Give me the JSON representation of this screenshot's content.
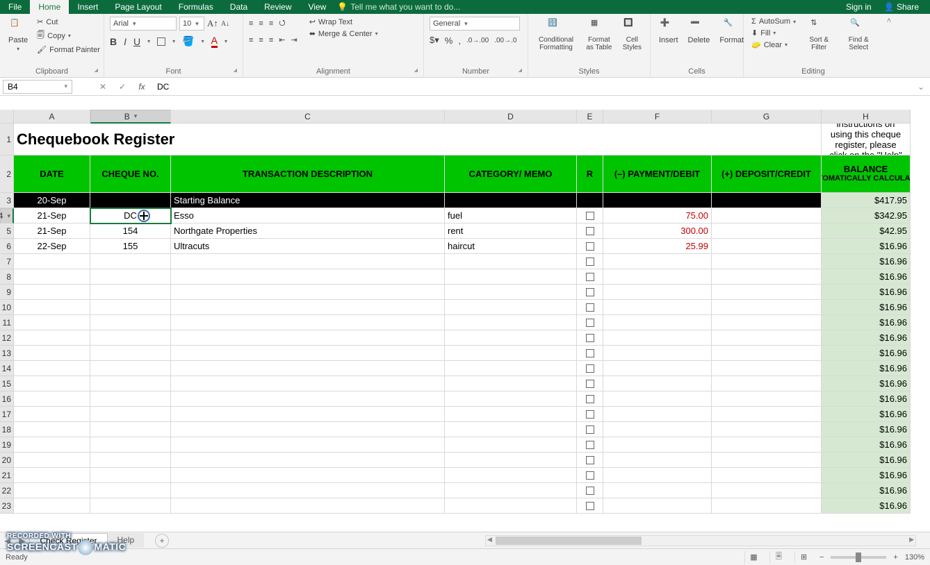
{
  "titlebar": {
    "tabs": [
      "File",
      "Home",
      "Insert",
      "Page Layout",
      "Formulas",
      "Data",
      "Review",
      "View"
    ],
    "active_tab": "Home",
    "tellme_placeholder": "Tell me what you want to do...",
    "signin": "Sign in",
    "share": "Share"
  },
  "ribbon": {
    "clipboard": {
      "paste": "Paste",
      "cut": "Cut",
      "copy": "Copy",
      "fmtpainter": "Format Painter",
      "label": "Clipboard"
    },
    "font": {
      "name": "Arial",
      "size": "10",
      "label": "Font"
    },
    "alignment": {
      "wrap": "Wrap Text",
      "merge": "Merge & Center",
      "label": "Alignment"
    },
    "number": {
      "fmt": "General",
      "label": "Number"
    },
    "styles": {
      "cond": "Conditional Formatting",
      "table": "Format as Table",
      "cell": "Cell Styles",
      "label": "Styles"
    },
    "cells": {
      "insert": "Insert",
      "delete": "Delete",
      "format": "Format",
      "label": "Cells"
    },
    "editing": {
      "autosum": "AutoSum",
      "fill": "Fill",
      "clear": "Clear",
      "sort": "Sort & Filter",
      "find": "Find & Select",
      "label": "Editing"
    }
  },
  "fx": {
    "cell": "B4",
    "formula": "DC"
  },
  "sheet": {
    "columns": [
      "A",
      "B",
      "C",
      "D",
      "E",
      "F",
      "G",
      "H"
    ],
    "title": "Chequebook Register",
    "help_text": "For help and instructions on using this cheque register, please click on the \"Help\" tab.",
    "headers": {
      "date": "DATE",
      "cheque": "CHEQUE NO.",
      "desc": "TRANSACTION DESCRIPTION",
      "cat": "CATEGORY/ MEMO",
      "r": "R",
      "debit": "(–) PAYMENT/DEBIT",
      "credit": "(+) DEPOSIT/CREDIT",
      "balance": "BALANCE (AUTOMATICALLY CALCULATES)"
    },
    "rows": [
      {
        "date": "20-Sep",
        "cheque": "",
        "desc": "Starting Balance",
        "cat": "",
        "r": "",
        "debit": "",
        "credit": "",
        "balance": "$417.95",
        "black": true
      },
      {
        "date": "21-Sep",
        "cheque": "DC",
        "desc": "Esso",
        "cat": "fuel",
        "r": "",
        "debit": "75.00",
        "credit": "",
        "balance": "$342.95",
        "sel": true
      },
      {
        "date": "21-Sep",
        "cheque": "154",
        "desc": "Northgate Properties",
        "cat": "rent",
        "r": "",
        "debit": "300.00",
        "credit": "",
        "balance": "$42.95"
      },
      {
        "date": "22-Sep",
        "cheque": "155",
        "desc": "Ultracuts",
        "cat": "haircut",
        "r": "",
        "debit": "25.99",
        "credit": "",
        "balance": "$16.96"
      }
    ],
    "empty_balance": "$16.96",
    "row_start": 3,
    "empty_rows": 17
  },
  "sheetbar": {
    "tabs": [
      "Check Register",
      "Help"
    ],
    "active": 0
  },
  "statusbar": {
    "ready": "Ready",
    "zoom": "130%"
  },
  "watermark": {
    "l1": "RECORDED WITH",
    "l2a": "SCREENCAST",
    "l2b": "MATIC"
  }
}
